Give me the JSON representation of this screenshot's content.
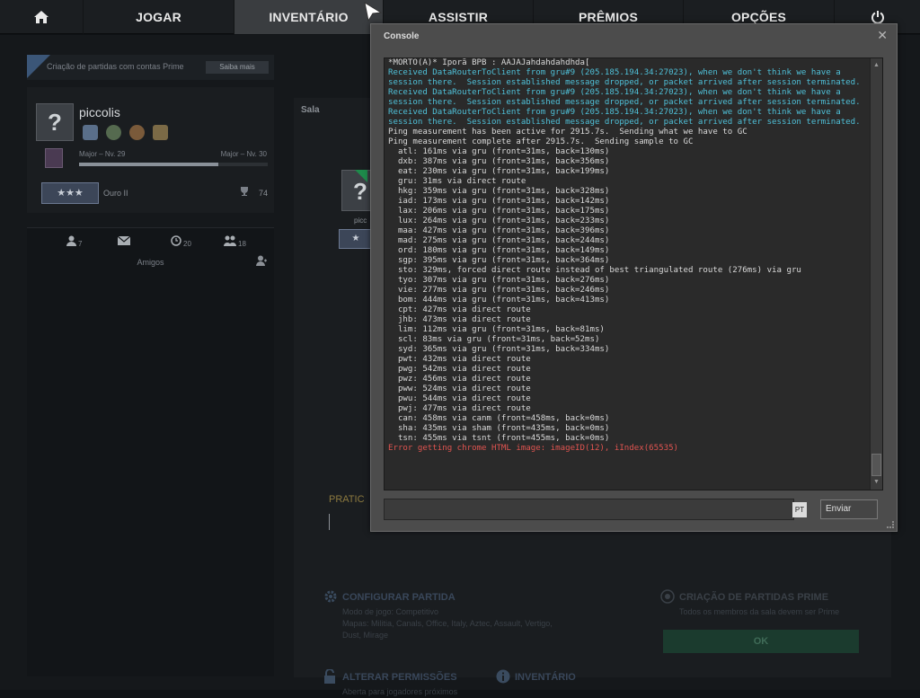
{
  "nav": {
    "items": [
      {
        "label": "JOGAR"
      },
      {
        "label": "INVENTÁRIO"
      },
      {
        "label": "ASSISTIR"
      },
      {
        "label": "PRÊMIOS"
      },
      {
        "label": "OPÇÕES"
      }
    ]
  },
  "prime_banner": {
    "text": "Criação de partidas com contas Prime",
    "button": "Saiba mais"
  },
  "profile": {
    "name": "piccolis",
    "rank_left": "Major – Nv. 29",
    "rank_right": "Major – Nv. 30",
    "rank_progress": 0.74,
    "skill_group": "Ouro II",
    "trophy_count": "74"
  },
  "friends": {
    "online": "7",
    "messages": "",
    "recent": "20",
    "groups": "18",
    "label": "Amigos"
  },
  "lobby": {
    "title": "Sala",
    "player_name": "picc",
    "practice_label": "PRATIC",
    "configure_title": "CONFIGURAR PARTIDA",
    "configure_lines": [
      "Modo de jogo: Competitivo",
      "Mapas: Militia, Canals, Office, Italy, Aztec, Assault, Vertigo,",
      "Dust, Mirage"
    ],
    "prime_title": "CRIAÇÃO DE PARTIDAS PRIME",
    "prime_line": "Todos os membros da sala devem ser Prime",
    "permissions_title": "ALTERAR PERMISSÕES",
    "permissions_line": "Aberta para jogadores próximos",
    "inventory_link": "INVENTÁRIO",
    "ok_button": "OK"
  },
  "console": {
    "title": "Console",
    "close": "✕",
    "send_button": "Enviar",
    "lang": "PT",
    "lines": [
      {
        "text": "*MORTO(A)* Iporã BPB : AAJAJahdahdahdhda[",
        "color": "white"
      },
      {
        "text": "Received DataRouterToClient from gru#9 (205.185.194.34:27023), when we don't think we have a session there.  Session established message dropped, or packet arrived after session terminated.",
        "color": "cyan"
      },
      {
        "text": "Received DataRouterToClient from gru#9 (205.185.194.34:27023), when we don't think we have a session there.  Session established message dropped, or packet arrived after session terminated.",
        "color": "cyan"
      },
      {
        "text": "Received DataRouterToClient from gru#9 (205.185.194.34:27023), when we don't think we have a session there.  Session established message dropped, or packet arrived after session terminated.",
        "color": "cyan"
      },
      {
        "text": "Ping measurement has been active for 2915.7s.  Sending what we have to GC",
        "color": "white"
      },
      {
        "text": "Ping measurement complete after 2915.7s.  Sending sample to GC",
        "color": "white"
      },
      {
        "text": "  atl: 161ms via gru (front=31ms, back=130ms)",
        "color": "white"
      },
      {
        "text": "  dxb: 387ms via gru (front=31ms, back=356ms)",
        "color": "white"
      },
      {
        "text": "  eat: 230ms via gru (front=31ms, back=199ms)",
        "color": "white"
      },
      {
        "text": "  gru: 31ms via direct route",
        "color": "white"
      },
      {
        "text": "  hkg: 359ms via gru (front=31ms, back=328ms)",
        "color": "white"
      },
      {
        "text": "  iad: 173ms via gru (front=31ms, back=142ms)",
        "color": "white"
      },
      {
        "text": "  lax: 206ms via gru (front=31ms, back=175ms)",
        "color": "white"
      },
      {
        "text": "  lux: 264ms via gru (front=31ms, back=233ms)",
        "color": "white"
      },
      {
        "text": "  maa: 427ms via gru (front=31ms, back=396ms)",
        "color": "white"
      },
      {
        "text": "  mad: 275ms via gru (front=31ms, back=244ms)",
        "color": "white"
      },
      {
        "text": "  ord: 180ms via gru (front=31ms, back=149ms)",
        "color": "white"
      },
      {
        "text": "  sgp: 395ms via gru (front=31ms, back=364ms)",
        "color": "white"
      },
      {
        "text": "  sto: 329ms, forced direct route instead of best triangulated route (276ms) via gru",
        "color": "white"
      },
      {
        "text": "  tyo: 307ms via gru (front=31ms, back=276ms)",
        "color": "white"
      },
      {
        "text": "  vie: 277ms via gru (front=31ms, back=246ms)",
        "color": "white"
      },
      {
        "text": "  bom: 444ms via gru (front=31ms, back=413ms)",
        "color": "white"
      },
      {
        "text": "  cpt: 427ms via direct route",
        "color": "white"
      },
      {
        "text": "  jhb: 473ms via direct route",
        "color": "white"
      },
      {
        "text": "  lim: 112ms via gru (front=31ms, back=81ms)",
        "color": "white"
      },
      {
        "text": "  scl: 83ms via gru (front=31ms, back=52ms)",
        "color": "white"
      },
      {
        "text": "  syd: 365ms via gru (front=31ms, back=334ms)",
        "color": "white"
      },
      {
        "text": "  pwt: 432ms via direct route",
        "color": "white"
      },
      {
        "text": "  pwg: 542ms via direct route",
        "color": "white"
      },
      {
        "text": "  pwz: 456ms via direct route",
        "color": "white"
      },
      {
        "text": "  pww: 524ms via direct route",
        "color": "white"
      },
      {
        "text": "  pwu: 544ms via direct route",
        "color": "white"
      },
      {
        "text": "  pwj: 477ms via direct route",
        "color": "white"
      },
      {
        "text": "  can: 458ms via canm (front=458ms, back=0ms)",
        "color": "white"
      },
      {
        "text": "  sha: 435ms via sham (front=435ms, back=0ms)",
        "color": "white"
      },
      {
        "text": "  tsn: 455ms via tsnt (front=455ms, back=0ms)",
        "color": "white"
      },
      {
        "text": "Error getting chrome HTML image: imageID(12), iIndex(65535)",
        "color": "red"
      }
    ]
  },
  "colors": {
    "accent_green": "#1b3b2e",
    "console_cyan": "#4fc0d8",
    "console_red": "#e05450"
  },
  "icons": [
    "home-icon",
    "power-icon",
    "close-icon",
    "user-icon",
    "mail-icon",
    "clock-icon",
    "group-icon",
    "trophy-icon",
    "gear-icon",
    "lock-icon",
    "info-icon"
  ]
}
